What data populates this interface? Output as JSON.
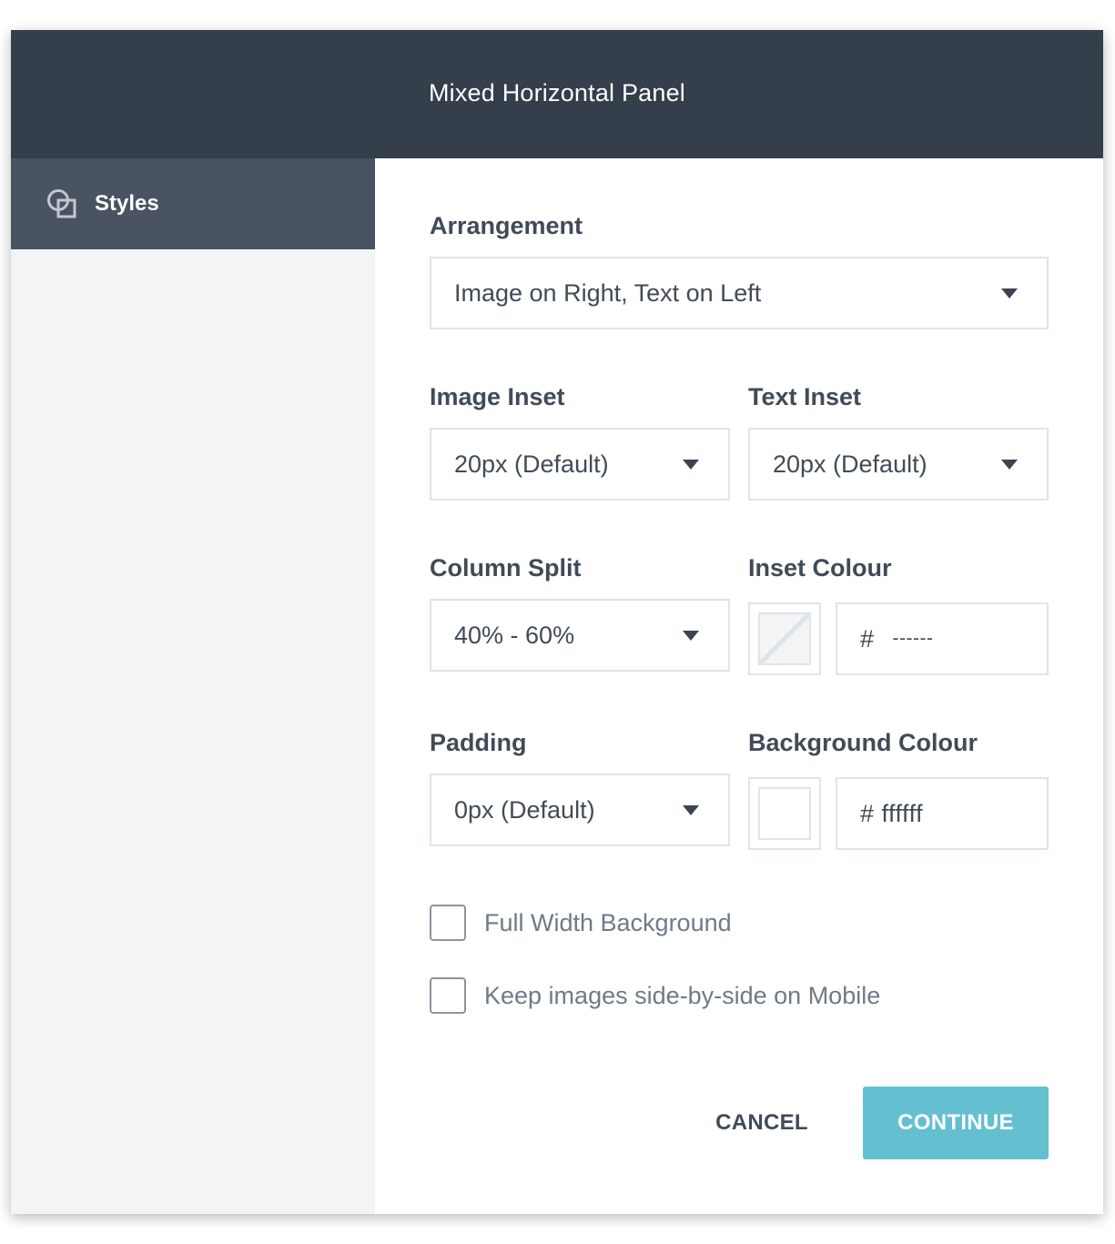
{
  "header": {
    "title": "Mixed Horizontal Panel"
  },
  "sidebar": {
    "items": [
      {
        "label": "Styles",
        "icon": "styles-icon",
        "active": true
      }
    ]
  },
  "form": {
    "arrangement": {
      "label": "Arrangement",
      "value": "Image on Right, Text on Left"
    },
    "image_inset": {
      "label": "Image Inset",
      "value": "20px (Default)"
    },
    "text_inset": {
      "label": "Text Inset",
      "value": "20px (Default)"
    },
    "column_split": {
      "label": "Column Split",
      "value": "40% - 60%"
    },
    "inset_colour": {
      "label": "Inset Colour",
      "hash": "#",
      "value": "------"
    },
    "padding": {
      "label": "Padding",
      "value": "0px (Default)"
    },
    "background_colour": {
      "label": "Background Colour",
      "value": "# ffffff",
      "color": "#ffffff"
    },
    "full_width_background": {
      "label": "Full Width Background",
      "checked": false
    },
    "keep_images_side_by_side": {
      "label": "Keep images side-by-side on Mobile",
      "checked": false
    }
  },
  "actions": {
    "cancel": "CANCEL",
    "continue": "CONTINUE"
  },
  "colors": {
    "header_bg": "#353e4b",
    "sidebar_active_bg": "#4a5362",
    "sidebar_bg": "#f3f4f6",
    "primary_button": "#64bfd1",
    "border": "#dfe4e9",
    "text": "#414b57"
  }
}
